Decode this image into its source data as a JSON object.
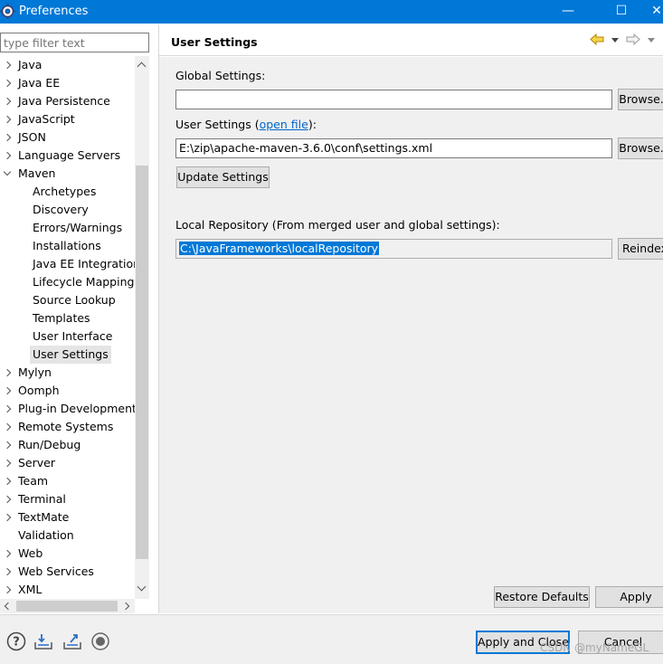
{
  "window": {
    "title": "Preferences"
  },
  "filter": {
    "placeholder": "type filter text"
  },
  "tree": [
    {
      "label": "Java",
      "level": 0,
      "expandable": true
    },
    {
      "label": "Java EE",
      "level": 0,
      "expandable": true
    },
    {
      "label": "Java Persistence",
      "level": 0,
      "expandable": true
    },
    {
      "label": "JavaScript",
      "level": 0,
      "expandable": true
    },
    {
      "label": "JSON",
      "level": 0,
      "expandable": true
    },
    {
      "label": "Language Servers",
      "level": 0,
      "expandable": true
    },
    {
      "label": "Maven",
      "level": 0,
      "expandable": true,
      "expanded": true
    },
    {
      "label": "Archetypes",
      "level": 1
    },
    {
      "label": "Discovery",
      "level": 1
    },
    {
      "label": "Errors/Warnings",
      "level": 1
    },
    {
      "label": "Installations",
      "level": 1
    },
    {
      "label": "Java EE Integration",
      "level": 1
    },
    {
      "label": "Lifecycle Mappings",
      "level": 1
    },
    {
      "label": "Source Lookup",
      "level": 1
    },
    {
      "label": "Templates",
      "level": 1
    },
    {
      "label": "User Interface",
      "level": 1
    },
    {
      "label": "User Settings",
      "level": 1,
      "selected": true
    },
    {
      "label": "Mylyn",
      "level": 0,
      "expandable": true
    },
    {
      "label": "Oomph",
      "level": 0,
      "expandable": true
    },
    {
      "label": "Plug-in Development",
      "level": 0,
      "expandable": true
    },
    {
      "label": "Remote Systems",
      "level": 0,
      "expandable": true
    },
    {
      "label": "Run/Debug",
      "level": 0,
      "expandable": true
    },
    {
      "label": "Server",
      "level": 0,
      "expandable": true
    },
    {
      "label": "Team",
      "level": 0,
      "expandable": true
    },
    {
      "label": "Terminal",
      "level": 0,
      "expandable": true
    },
    {
      "label": "TextMate",
      "level": 0,
      "expandable": true
    },
    {
      "label": "Validation",
      "level": 0,
      "expandable": false
    },
    {
      "label": "Web",
      "level": 0,
      "expandable": true
    },
    {
      "label": "Web Services",
      "level": 0,
      "expandable": true
    },
    {
      "label": "XML",
      "level": 0,
      "expandable": true
    }
  ],
  "page": {
    "title": "User Settings",
    "global_label": "Global Settings:",
    "global_value": "",
    "browse_label": "Browse...",
    "user_label_prefix": "User Settings (",
    "user_label_link": "open file",
    "user_label_suffix": "):",
    "user_value": "E:\\zip\\apache-maven-3.6.0\\conf\\settings.xml",
    "update_label": "Update Settings",
    "local_repo_label": "Local Repository (From merged user and global settings):",
    "local_repo_value": "C:\\JavaFrameworks\\localRepository",
    "reindex_label": "Reindex",
    "restore_label": "Restore Defaults",
    "apply_label": "Apply"
  },
  "footer": {
    "apply_close_label": "Apply and Close",
    "cancel_label": "Cancel",
    "watermark": "CSDN @myNameGL"
  },
  "colors": {
    "titlebar": "#0078d7",
    "selection": "#0078d7",
    "link": "#0066cc"
  }
}
